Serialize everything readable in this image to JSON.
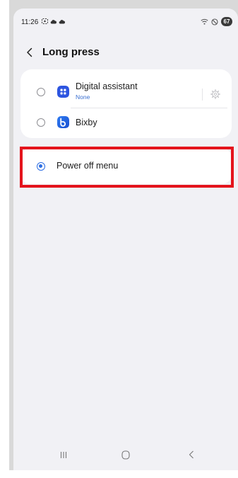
{
  "status_bar": {
    "time": "11:26",
    "battery": "67"
  },
  "header": {
    "title": "Long press"
  },
  "options": {
    "digital_assistant": {
      "label": "Digital assistant",
      "subtitle": "None"
    },
    "bixby": {
      "label": "Bixby"
    },
    "power_off": {
      "label": "Power off menu",
      "selected": true
    }
  },
  "colors": {
    "accent": "#2c6de3",
    "highlight_border": "#e4141c",
    "screen_bg": "#f1f1f5"
  },
  "icons": {
    "back": "chevron-left-icon",
    "settings": "gear-icon",
    "nav_recents": "recents-icon",
    "nav_home": "home-icon",
    "nav_back": "back-icon"
  }
}
